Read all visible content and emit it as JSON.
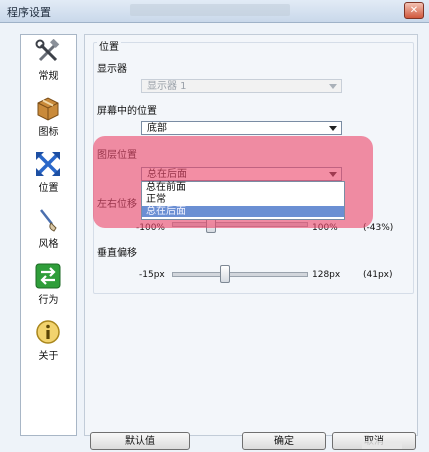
{
  "window": {
    "title": "程序设置"
  },
  "sidebar": {
    "items": [
      {
        "label": "常规",
        "icon": "tools-icon"
      },
      {
        "label": "图标",
        "icon": "package-icon"
      },
      {
        "label": "位置",
        "icon": "move-arrows-icon"
      },
      {
        "label": "风格",
        "icon": "brush-icon"
      },
      {
        "label": "行为",
        "icon": "switch-arrows-icon"
      },
      {
        "label": "关于",
        "icon": "info-icon"
      }
    ],
    "selected_index": 2
  },
  "position": {
    "group_title": "位置",
    "monitor": {
      "label": "显示器",
      "value": "显示器 1"
    },
    "screen_position": {
      "label": "屏幕中的位置",
      "value": "底部"
    },
    "layer": {
      "label": "图层位置",
      "value": "总在后面",
      "options": [
        "总在前面",
        "正常",
        "总在后面"
      ],
      "highlighted_index": 2
    },
    "horizontal_offset": {
      "label": "左右位移",
      "min": "-100%",
      "max": "100%",
      "value_text": "(-43%)",
      "value": -43
    },
    "vertical_offset": {
      "label": "垂直偏移",
      "min": "-15px",
      "max": "128px",
      "value_text": "(41px)",
      "value": 41
    }
  },
  "buttons": {
    "default": "默认值",
    "ok": "确定",
    "cancel": "取消"
  },
  "colors": {
    "highlight": "#ec486c",
    "selected_option": "#6b8fd3",
    "accent": "#2a67c9"
  }
}
